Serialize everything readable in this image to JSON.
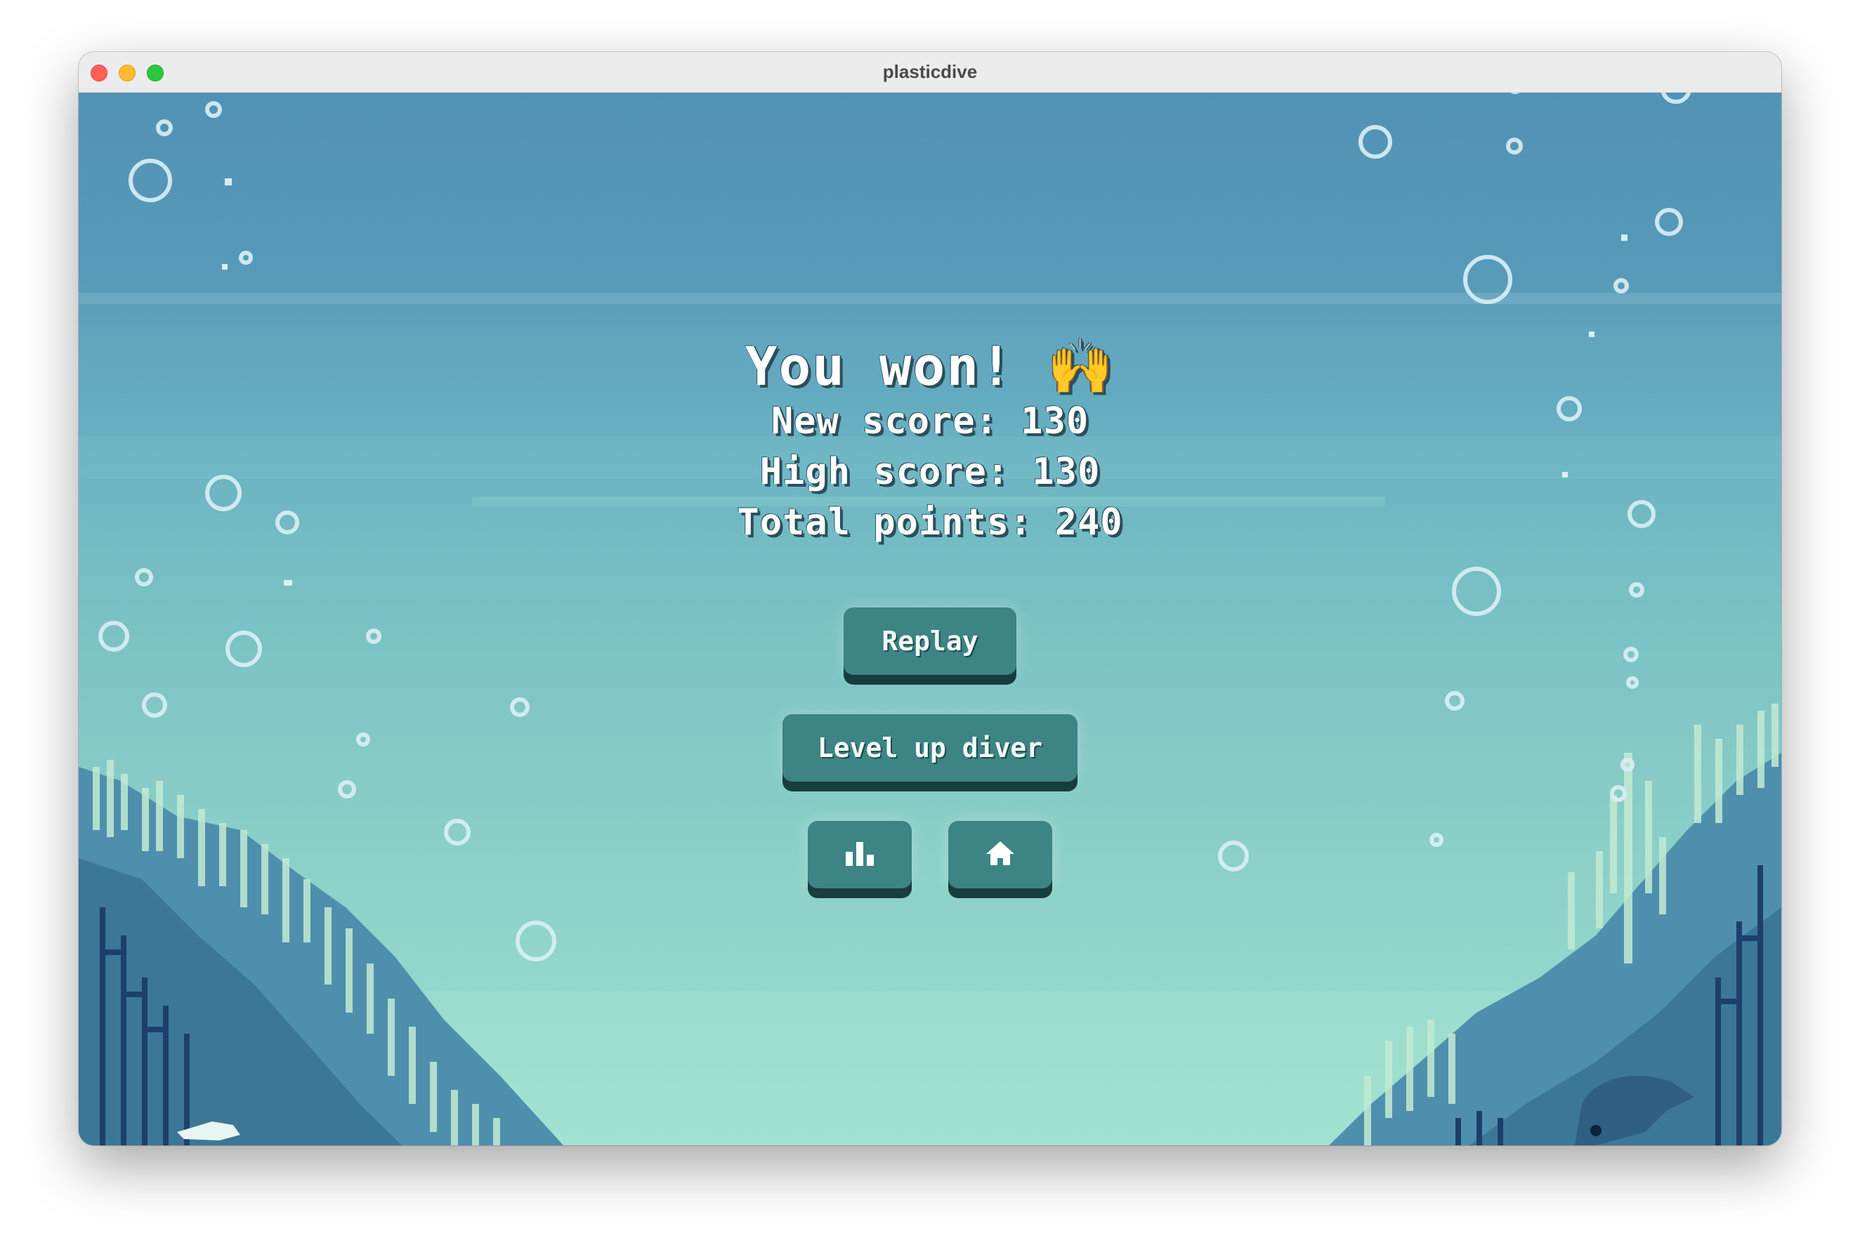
{
  "window": {
    "title": "plasticdive"
  },
  "result": {
    "heading": "You won! 🙌",
    "new_score": "New score: 130",
    "high_score": "High score: 130",
    "total_points": "Total points: 240"
  },
  "buttons": {
    "replay": "Replay",
    "level_up": "Level up diver",
    "leaderboard_icon": "bar-chart-icon",
    "home_icon": "home-icon"
  },
  "colors": {
    "button": "#3d8484",
    "button_shadow": "#173d3f",
    "water_top": "#5293b5",
    "water_bottom": "#9ee0cf"
  }
}
